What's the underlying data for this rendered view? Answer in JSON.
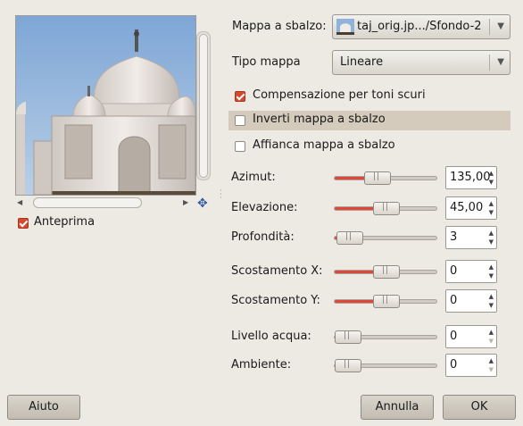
{
  "preview": {
    "checkbox_label": "Anteprima",
    "checked": true
  },
  "bump_map": {
    "label": "Mappa a sbalzo:",
    "value": "taj_orig.jp.../Sfondo-2"
  },
  "map_type": {
    "label": "Tipo mappa",
    "value": "Lineare"
  },
  "options": {
    "compensate": {
      "label": "Compensazione per toni scuri",
      "checked": true
    },
    "invert": {
      "label": "Inverti mappa a sbalzo",
      "checked": false
    },
    "tile": {
      "label": "Affianca mappa a sbalzo",
      "checked": false
    }
  },
  "sliders": [
    {
      "label": "Azimut:",
      "value": "135,00",
      "level": 0.38
    },
    {
      "label": "Elevazione:",
      "value": "45,00",
      "level": 0.5
    },
    {
      "label": "Profondità:",
      "value": "3",
      "level": 0.02
    },
    {
      "label": "Scostamento X:",
      "value": "0",
      "level": 0.5
    },
    {
      "label": "Scostamento Y:",
      "value": "0",
      "level": 0.5
    },
    {
      "label": "Livello acqua:",
      "value": "0",
      "level": 0.0
    },
    {
      "label": "Ambiente:",
      "value": "0",
      "level": 0.0
    }
  ],
  "buttons": {
    "help": "Aiuto",
    "cancel": "Annulla",
    "ok": "OK"
  },
  "colors": {
    "accent": "#e0473a",
    "background": "#edeae4",
    "highlight_row": "#d4cbbd"
  }
}
